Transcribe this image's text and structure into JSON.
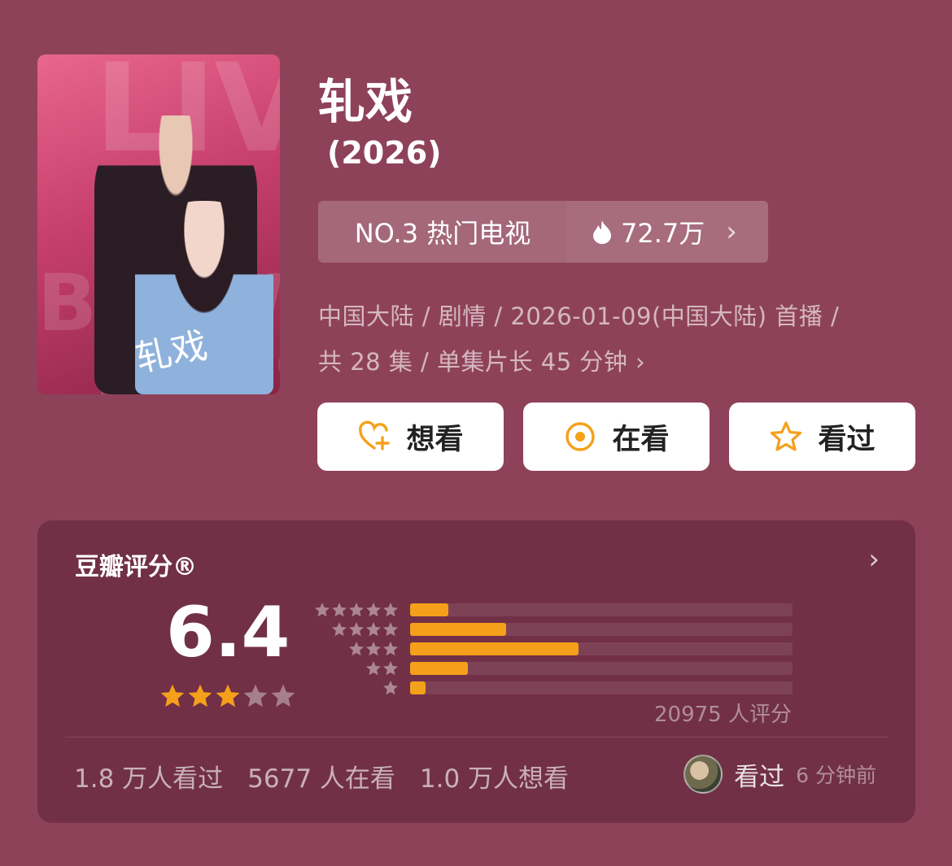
{
  "show": {
    "title": "轧戏",
    "year": "(2026)",
    "rank_label": "NO.3 热门电视",
    "heat_value": "72.7万",
    "meta_line1": "中国大陆 / 剧情 / 2026-01-09(中国大陆) 首播 /",
    "meta_line2": "共 28 集 / 单集片长 45 分钟"
  },
  "actions": {
    "want": "想看",
    "watching": "在看",
    "watched": "看过"
  },
  "rating": {
    "title": "豆瓣评分®",
    "score": "6.4",
    "score_stars": 3,
    "count_text": "20975 人评分",
    "distribution": [
      {
        "stars": 5,
        "fraction": 0.1
      },
      {
        "stars": 4,
        "fraction": 0.25
      },
      {
        "stars": 3,
        "fraction": 0.44
      },
      {
        "stars": 2,
        "fraction": 0.15
      },
      {
        "stars": 1,
        "fraction": 0.04
      }
    ]
  },
  "stats": {
    "watched": "1.8 万人看过",
    "watching": "5677 人在看",
    "want": "1.0 万人想看"
  },
  "recent": {
    "label": "看过",
    "time": "6 分钟前"
  },
  "colors": {
    "background": "#8e4259",
    "accent": "#f5a01a",
    "heat": "#ffffff"
  }
}
